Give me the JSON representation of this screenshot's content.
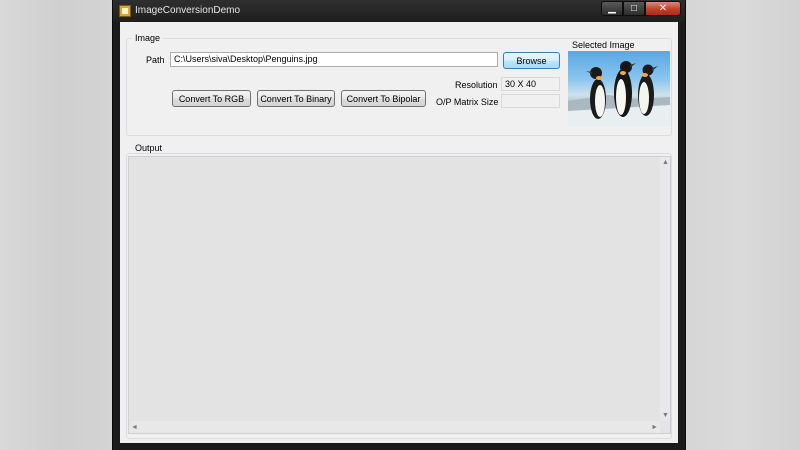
{
  "window": {
    "title": "ImageConversionDemo",
    "controls": {
      "minimize": "▁",
      "maximize": "□",
      "close": "✕"
    }
  },
  "image_group": {
    "legend": "Image",
    "path_label": "Path",
    "path_value": "C:\\Users\\siva\\Desktop\\Penguins.jpg",
    "browse_label": "Browse",
    "selected_image_label": "Selected Image",
    "resolution_label": "Resolution",
    "resolution_value": "30 X 40",
    "matrix_size_label": "O/P Matrix Size",
    "matrix_size_value": "",
    "buttons": {
      "rgb": "Convert To RGB",
      "binary": "Convert To Binary",
      "bipolar": "Convert To Bipolar"
    }
  },
  "output_group": {
    "legend": "Output",
    "content": ""
  },
  "scrollbar": {
    "up": "▲",
    "down": "▼",
    "left": "◄",
    "right": "►"
  },
  "icons": {
    "app": "app-form-icon",
    "preview": "penguins-image"
  }
}
